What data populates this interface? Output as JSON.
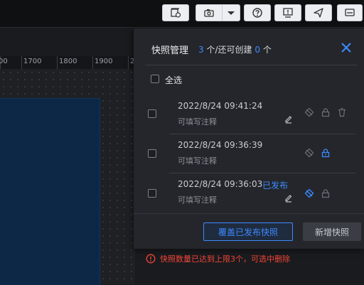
{
  "toolbar": {
    "buttons": [
      {
        "name": "screenshot-settings-icon"
      },
      {
        "name": "camera-icon"
      },
      {
        "name": "chevron-down-icon"
      },
      {
        "name": "help-icon"
      },
      {
        "name": "alert-icon"
      },
      {
        "name": "send-icon"
      },
      {
        "name": "monitor-icon"
      }
    ]
  },
  "ruler": {
    "labels": [
      "00",
      "1700",
      "1800",
      "1900",
      "2"
    ]
  },
  "snapshot_panel": {
    "title": "快照管理",
    "count_current": "3",
    "count_unit": "个/还可创建",
    "count_remaining": "0",
    "count_suffix": "个",
    "select_all_label": "全选",
    "rows": [
      {
        "timestamp": "2022/8/24 09:41:24",
        "note_placeholder": "可填写注释",
        "status": ""
      },
      {
        "timestamp": "2022/8/24 09:36:39",
        "note_placeholder": "可填写注释",
        "status": ""
      },
      {
        "timestamp": "2022/8/24 09:36:03",
        "note_placeholder": "可填写注释",
        "status": "已发布"
      }
    ],
    "overwrite_button": "覆盖已发布快照",
    "new_button": "新增快照"
  },
  "warning": {
    "text": "快照数量已达到上限3个，可选中删除"
  },
  "colors": {
    "accent": "#3d8bff",
    "error": "#f04438",
    "panel_bg": "#24262b"
  }
}
